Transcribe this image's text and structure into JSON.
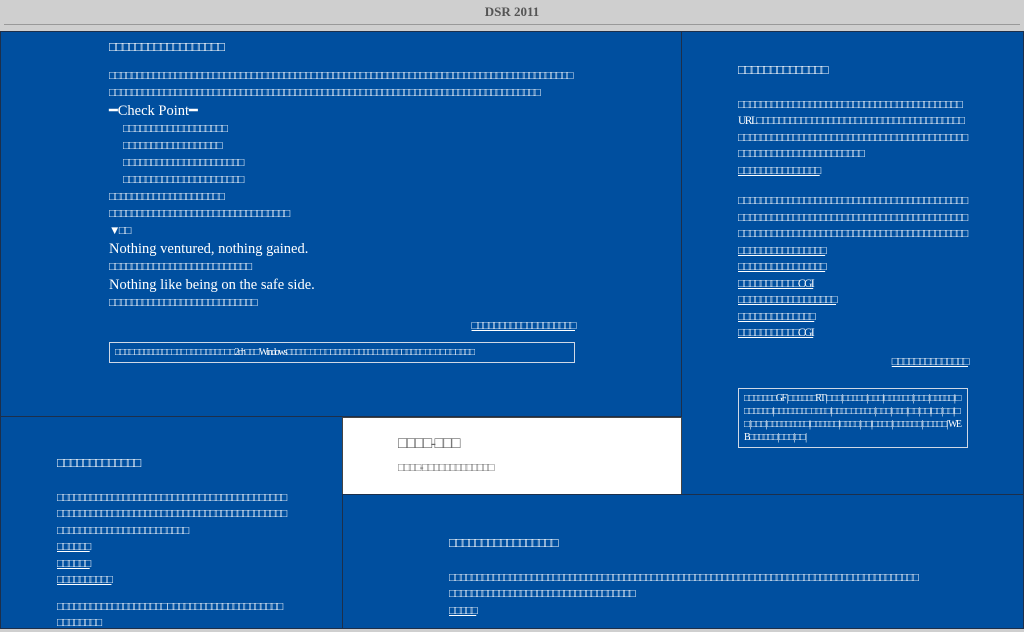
{
  "header": {
    "title": "DSR 2011"
  },
  "panel_a": {
    "title": "□□□□□□□□□□□□□□□□□□",
    "intro": "□□□□□□□□□□□□□□□□□□□□□□□□□□□□□□□□□□□□□□□□□□□□□□□□□□□□□□□□□□□□□□□□□□□□□□□□□□□□□□□□□□□□□□□□□□□□□□□□□□□□□□□□□□□□□□□□□□□□□□□□□□□□□□□□□□□□□□□□□□□□□□□□□□□□□□□□□□□□□□□□□□□□",
    "check_title": "━Check Point━",
    "checks": [
      "□□□□□□□□□□□□□□□□□□□",
      "□□□□□□□□□□□□□□□□□□",
      "□□□□□□□□□□□□□□□□□□□□□□",
      "□□□□□□□□□□□□□□□□□□□□□□"
    ],
    "line1": "□□□□□□□□□□□□□□□□□□□□□",
    "line2": "□□□□□□□□□□□□□□□□□□□□□□□□□□□□□□□□□",
    "toggle": "▼□□",
    "quote1": "Nothing ventured, nothing gained.",
    "quote1_jp": "□□□□□□□□□□□□□□□□□□□□□□□□□□",
    "quote2": "Nothing like being on the safe side.",
    "quote2_jp": "□□□□□□□□□□□□□□□□□□□□□□□□□□□",
    "more_link": "□□□□□□□□□□□□□□□□□□□",
    "tags": "□□□□ □□□□□□□□ □□□ □□□ □□□□□ □□ 2ch□□□ Windows□□□□□ □□ □□ □□□□□ □□□□□ □□□□□ □□□□□ □□ □□ □□ □□□□"
  },
  "panel_b": {
    "title": "□□□□□□□□□□□□□□",
    "para1": "□□□□□□□□□□□□□□□□□□□□□□□□□□□□□□□□□□□□□□□□□URL□□□□□□□□□□□□□□□□□□□□□□□□□□□□□□□□□□□□□□□□□□□□□□□□□□□□□□□□□□□□□□□□□□□□□□□□□□□□□□□□□□□□□□□□□□□□□□□□□□□□□□□",
    "link1": "□□□□□□□□□□□□□□□",
    "para2": "□□□□□□□□□□□□□□□□□□□□□□□□□□□□□□□□□□□□□□□□□□□□□□□□□□□□□□□□□□□□□□□□□□□□□□□□□□□□□□□□□□□□□□□□□□□□□□□□□□□□□□□□□□□□□□□□□□□□□□□□□□□□□□",
    "links": [
      "□□□□□□□□□□□□□□□□",
      "□□□□□□□□□□□□□□□□",
      "□□□□□□□□□□□CGI",
      "□□□□□□□□□□□□□□□□□□",
      "□□□□□□□□□□□□□□",
      "□□□□□□□□□□□CGI"
    ],
    "more_link": "□□□□□□□□□□□□□□",
    "tags": "□□□□□□□GF | □□□□□□RT | □□□ | □□□□□ | □□□ | □□□□□□ | □□□ | □□□□□ | □□□□□□□ | □□□□□□□□ □□□□ | □□□□ □□□□□ | □□□ | □□□ | □□ | □□ | □□ | □□ | □□ | □□□ | □□□□□□□□□ | □□□□□□ | □□□□ | □□ | □□□□ | □□□□□□ | □□□□□ | WEB□□□□□□ | □□□ | □□ |"
  },
  "panel_c": {
    "title": "□□□□□□□□□□□□□",
    "para": "□□□□□□□□□□□□□□□□□□□□□□□□□□□□□□□□□□□□□□□□□□□□□□□□□□□□□□□□□□□□□□□□□□□□□□□□□□□□□□□□□□□□□□□□□□□□□□□□□□□□□□□□□□□□",
    "rows": [
      "□□□□□□",
      "□□□□□□",
      "□□□□□□□□□□"
    ],
    "para2": "□□□□□□□□□□□□□□□□□□□□ □□□□□□□□□□□□□□□□□□□□□□□□□□□□□"
  },
  "panel_d": {
    "title": "□□□□-□□□",
    "subtitle": "□□□□-□□□□□□□□□□□□□"
  },
  "panel_e": {
    "title": "□□□□□□□□□□□□□□□□□",
    "para": "□□□□□□□□□□□□□□□□□□□□□□□□□□□□□□□□□□□□□□□□□□□□□□□□□□□□□□□□□□□□□□□□□□□□□□□□□□□□□□□□□□□□□□□□□□□□□□□□□□□□□□□□□□□□□□□□□□□□□□□□",
    "link": "□□□□□"
  }
}
